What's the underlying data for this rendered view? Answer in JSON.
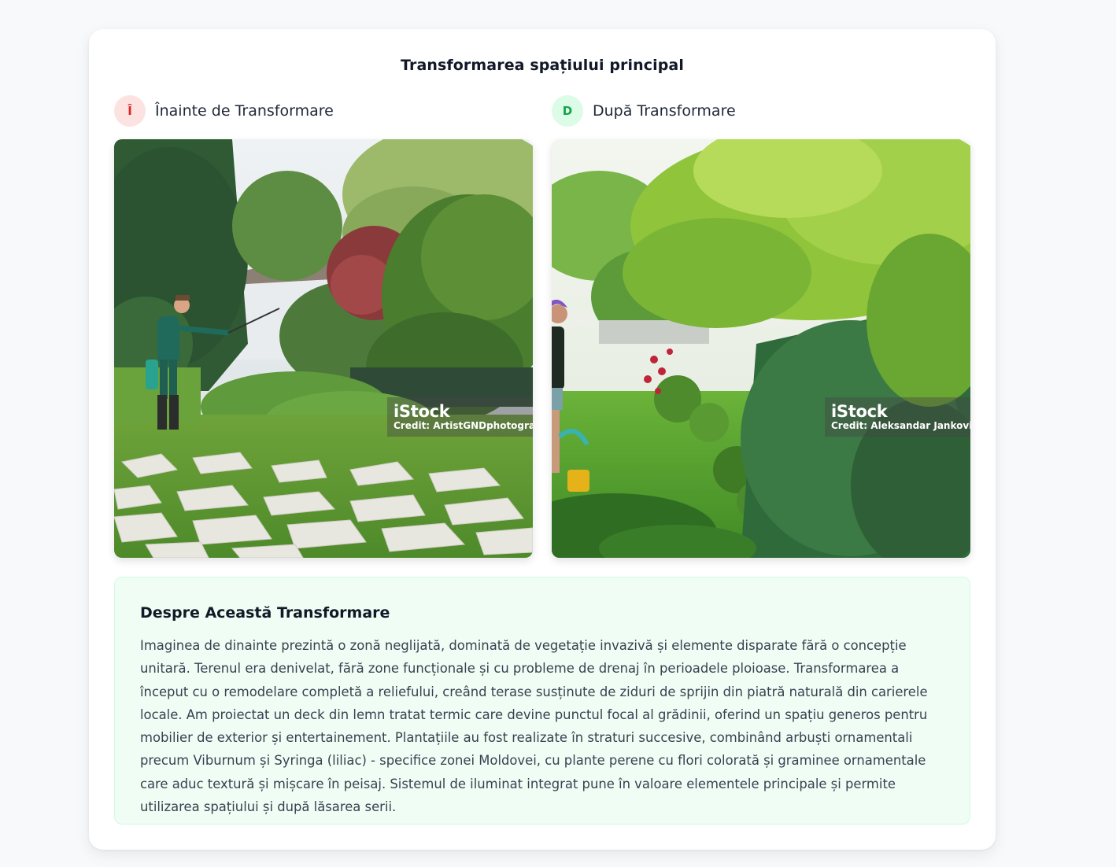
{
  "section": {
    "title": "Transformarea spațiului principal"
  },
  "before": {
    "badge": "Î",
    "label": "Înainte de Transformare",
    "watermark_brand": "iStock",
    "watermark_credit": "Credit: ArtistGNDphotography"
  },
  "after": {
    "badge": "D",
    "label": "După Transformare",
    "watermark_brand": "iStock",
    "watermark_credit": "Credit: Aleksandar Jankovic"
  },
  "about": {
    "title": "Despre Această Transformare",
    "body": "Imaginea de dinainte prezintă o zonă neglijată, dominată de vegetație invazivă și elemente disparate fără o concepție unitară. Terenul era denivelat, fără zone funcționale și cu probleme de drenaj în perioadele ploioase. Transformarea a început cu o remodelare completă a reliefului, creând terase susținute de ziduri de sprijin din piatră naturală din carierele locale. Am proiectat un deck din lemn tratat termic care devine punctul focal al grădinii, oferind un spațiu generos pentru mobilier de exterior și entertainement. Plantațiile au fost realizate în straturi succesive, combinând arbuști ornamentali precum Viburnum și Syringa (liliac) - specifice zonei Moldovei, cu plante perene cu flori colorată și graminee ornamentale care aduc textură și mișcare în peisaj. Sistemul de iluminat integrat pune în valoare elementele principale și permite utilizarea spațiului și după lăsarea serii."
  },
  "colors": {
    "before_badge_bg": "#fde2e2",
    "before_badge_text": "#dc2626",
    "after_badge_bg": "#dcfce7",
    "after_badge_text": "#16a34a",
    "about_bg": "#f0fdf4"
  }
}
